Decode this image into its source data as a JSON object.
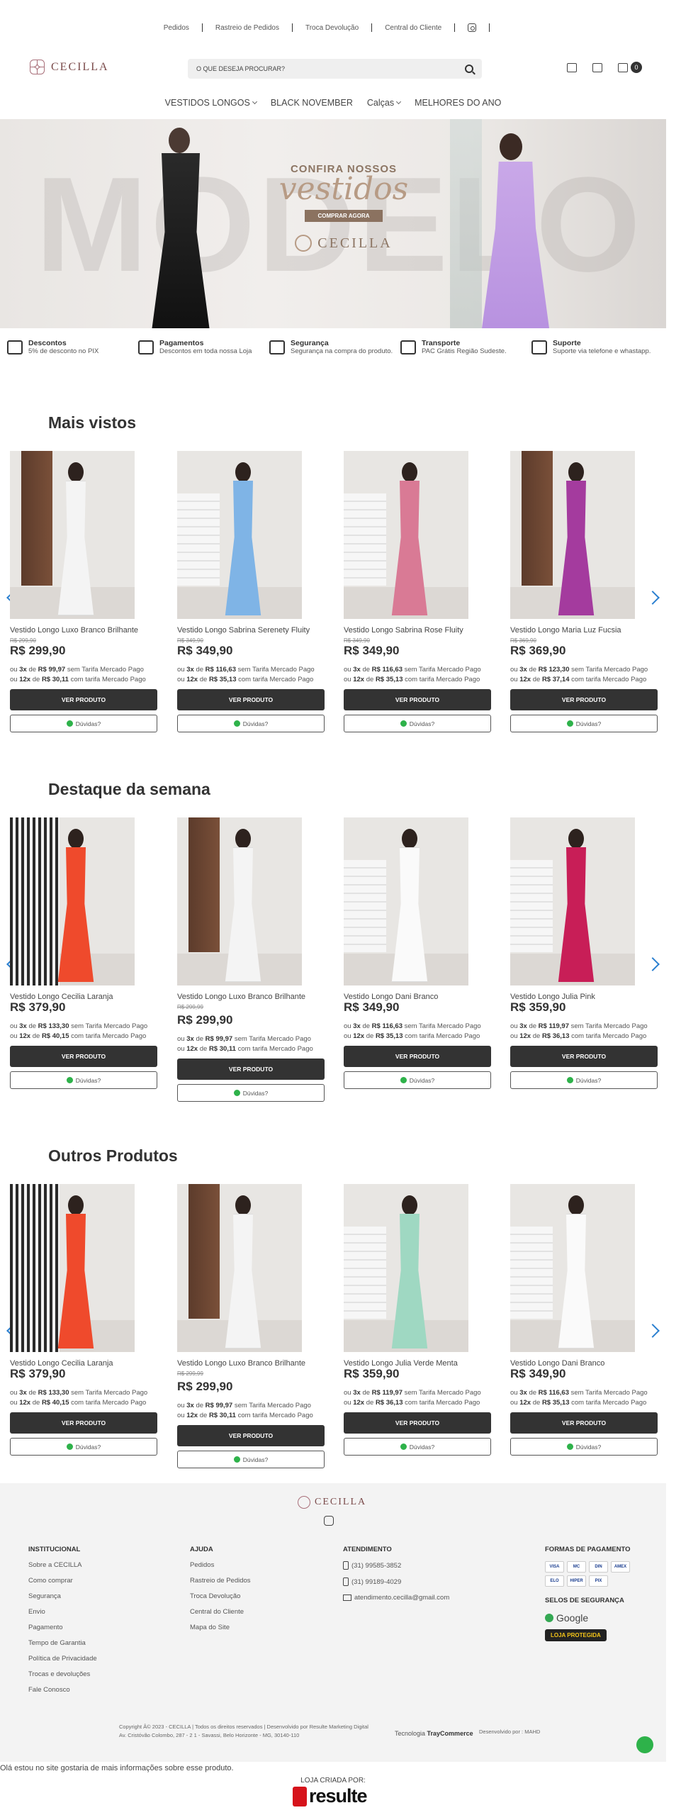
{
  "toplinks": [
    "Pedidos",
    "Rastreio de Pedidos",
    "Troca Devolução",
    "Central do Cliente"
  ],
  "header": {
    "logo": "CECILLA",
    "search_placeholder": "O QUE DESEJA PROCURAR?",
    "cart_count": "0"
  },
  "nav": [
    "VESTIDOS LONGOS",
    "BLACK NOVEMBER",
    "Calças",
    "MELHORES DO ANO"
  ],
  "banner": {
    "bigword": "MODELO",
    "headline": "CONFIRA NOSSOS",
    "script": "vestidos",
    "button": "COMPRAR AGORA",
    "logo": "CECILLA"
  },
  "features": [
    {
      "title": "Descontos",
      "desc": "5% de desconto no PIX",
      "icon": "tag-icon"
    },
    {
      "title": "Pagamentos",
      "desc": "Descontos em toda nossa Loja",
      "icon": "money-icon"
    },
    {
      "title": "Segurança",
      "desc": "Segurança na compra do produto.",
      "icon": "shield-icon"
    },
    {
      "title": "Transporte",
      "desc": "PAC Grátis Região Sudeste.",
      "icon": "truck-icon"
    },
    {
      "title": "Suporte",
      "desc": "Suporte via telefone e whastapp.",
      "icon": "chat-icon"
    }
  ],
  "labels": {
    "view": "VER PRODUTO",
    "doubts": "Dúvidas?",
    "ou": "ou",
    "de": "de",
    "sem": "sem Tarifa Mercado Pago",
    "com": "com tarifa Mercado Pago"
  },
  "sections": [
    {
      "title": "Mais vistos",
      "products": [
        {
          "name": "Vestido Longo Luxo Branco Brilhante",
          "old": "R$ 299,90",
          "price": "R$ 299,90",
          "i1n": "3x",
          "i1v": "R$ 99,97",
          "i2n": "12x",
          "i2v": "R$ 30,11",
          "color": "#f4f4f4",
          "bg": "door"
        },
        {
          "name": "Vestido Longo Sabrina Serenety Fluity",
          "old": "R$ 349,90",
          "price": "R$ 349,90",
          "i1n": "3x",
          "i1v": "R$ 116,63",
          "i2n": "12x",
          "i2v": "R$ 35,13",
          "color": "#7fb4e6",
          "bg": "stairs"
        },
        {
          "name": "Vestido Longo Sabrina Rose Fluity",
          "old": "R$ 349,90",
          "price": "R$ 349,90",
          "i1n": "3x",
          "i1v": "R$ 116,63",
          "i2n": "12x",
          "i2v": "R$ 35,13",
          "color": "#d97a95",
          "bg": "stairs"
        },
        {
          "name": "Vestido Longo Maria Luz Fucsia",
          "old": "R$ 369,90",
          "price": "R$ 369,90",
          "i1n": "3x",
          "i1v": "R$ 123,30",
          "i2n": "12x",
          "i2v": "R$ 37,14",
          "color": "#a43b9e",
          "bg": "door"
        }
      ]
    },
    {
      "title": "Destaque da semana",
      "products": [
        {
          "name": "Vestido Longo Cecilia Laranja",
          "old": "",
          "price": "R$ 379,90",
          "i1n": "3x",
          "i1v": "R$ 133,30",
          "i2n": "12x",
          "i2v": "R$ 40,15",
          "color": "#ef4a2c",
          "bg": "stripes"
        },
        {
          "name": "Vestido Longo Luxo Branco Brilhante",
          "old": "R$ 299,99",
          "price": "R$ 299,90",
          "i1n": "3x",
          "i1v": "R$ 99,97",
          "i2n": "12x",
          "i2v": "R$ 30,11",
          "color": "#f4f4f4",
          "bg": "door"
        },
        {
          "name": "Vestido Longo Dani Branco",
          "old": "",
          "price": "R$ 349,90",
          "i1n": "3x",
          "i1v": "R$ 116,63",
          "i2n": "12x",
          "i2v": "R$ 35,13",
          "color": "#fafafa",
          "bg": "stairs"
        },
        {
          "name": "Vestido Longo Julia Pink",
          "old": "",
          "price": "R$ 359,90",
          "i1n": "3x",
          "i1v": "R$ 119,97",
          "i2n": "12x",
          "i2v": "R$ 36,13",
          "color": "#c81e57",
          "bg": "stairs"
        }
      ]
    },
    {
      "title": "Outros Produtos",
      "products": [
        {
          "name": "Vestido Longo Cecilia Laranja",
          "old": "",
          "price": "R$ 379,90",
          "i1n": "3x",
          "i1v": "R$ 133,30",
          "i2n": "12x",
          "i2v": "R$ 40,15",
          "color": "#ef4a2c",
          "bg": "stripes"
        },
        {
          "name": "Vestido Longo Luxo Branco Brilhante",
          "old": "R$ 299,99",
          "price": "R$ 299,90",
          "i1n": "3x",
          "i1v": "R$ 99,97",
          "i2n": "12x",
          "i2v": "R$ 30,11",
          "color": "#f4f4f4",
          "bg": "door"
        },
        {
          "name": "Vestido Longo Julia Verde Menta",
          "old": "",
          "price": "R$ 359,90",
          "i1n": "3x",
          "i1v": "R$ 119,97",
          "i2n": "12x",
          "i2v": "R$ 36,13",
          "color": "#9fd8c2",
          "bg": "stairs"
        },
        {
          "name": "Vestido Longo Dani Branco",
          "old": "",
          "price": "R$ 349,90",
          "i1n": "3x",
          "i1v": "R$ 116,63",
          "i2n": "12x",
          "i2v": "R$ 35,13",
          "color": "#fafafa",
          "bg": "stairs"
        }
      ]
    }
  ],
  "footer": {
    "logo": "CECILLA",
    "institucional": {
      "title": "INSTITUCIONAL",
      "items": [
        "Sobre a CECILLA",
        "Como comprar",
        "Segurança",
        "Envio",
        "Pagamento",
        "Tempo de Garantia",
        "Política de Privacidade",
        "Trocas e devoluções",
        "Fale Conosco"
      ]
    },
    "ajuda": {
      "title": "AJUDA",
      "items": [
        "Pedidos",
        "Rastreio de Pedidos",
        "Troca Devolução",
        "Central do Cliente",
        "Mapa do Site"
      ]
    },
    "atendimento": {
      "title": "ATENDIMENTO",
      "phone1": "(31) 99585-3852",
      "phone2": "(31) 99189-4029",
      "email": "atendimento.cecilla@gmail.com"
    },
    "pagamento_title": "FORMAS DE PAGAMENTO",
    "pay_brands": [
      "VISA",
      "MC",
      "DIN",
      "AMEX",
      "ELO",
      "HIPER",
      "PIX"
    ],
    "selos_title": "SELOS DE SEGURANÇA",
    "google": "Google",
    "loja_protegida": "LOJA PROTEGIDA",
    "copyright": "Copyright Â© 2023 - CECILLA | Todos os direitos reservados | Desenvolvido por Resulte Marketing Digital",
    "address": "Av. Cristóvão Colombo, 287 - 2 1 - Savassi, Belo Horizonte - MG, 30140-110",
    "tray_prefix": "Tecnologia",
    "tray": "TrayCommerce",
    "dev": "Desenvolvido por : MAHD"
  },
  "whatsapp_note": "Olá estou no site gostaria de mais informações sobre esse produto.",
  "byline": "LOJA CRIADA POR:",
  "resulte": "resulte"
}
